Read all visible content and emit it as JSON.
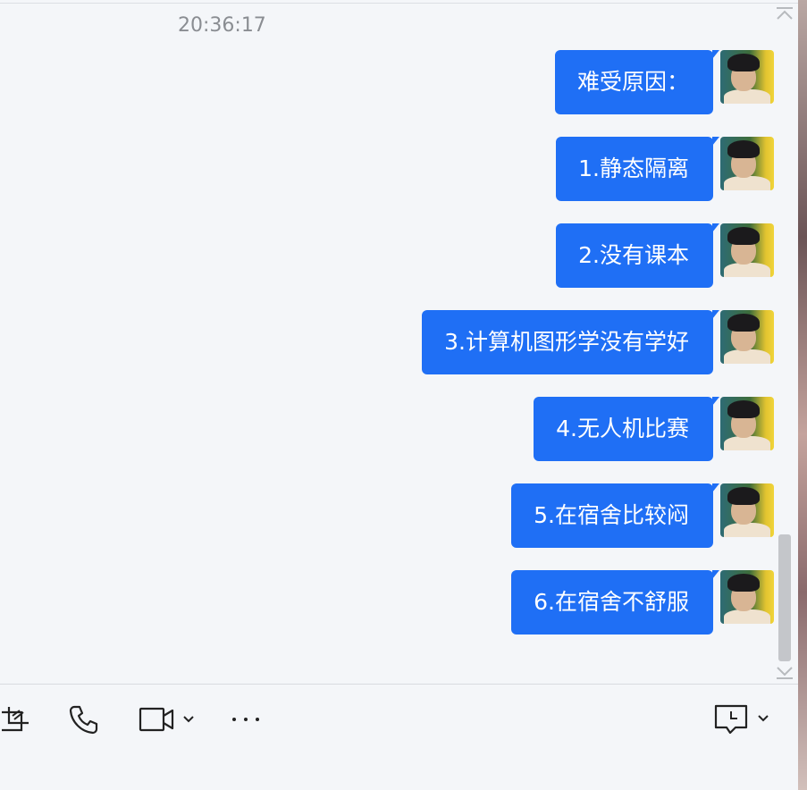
{
  "chat": {
    "timestamp": "20:36:17",
    "messages": [
      {
        "text": "难受原因："
      },
      {
        "text": "1.静态隔离"
      },
      {
        "text": "2.没有课本"
      },
      {
        "text": "3.计算机图形学没有学好"
      },
      {
        "text": "4.无人机比赛"
      },
      {
        "text": "5.在宿舍比较闷"
      },
      {
        "text": "6.在宿舍不舒服"
      }
    ]
  },
  "toolbar": {
    "icons": [
      "screenshot-icon",
      "phone-icon",
      "video-call-icon",
      "more-icon",
      "chat-history-icon"
    ]
  },
  "colors": {
    "bubble": "#1f6ff5",
    "bubble_text": "#ffffff",
    "background": "#f4f6f9",
    "timestamp": "#8a8d92"
  }
}
